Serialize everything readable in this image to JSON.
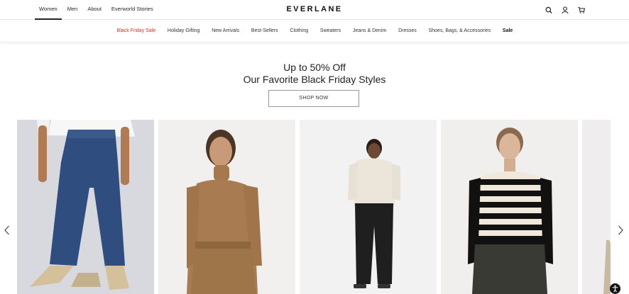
{
  "topnav": {
    "items": [
      "Women",
      "Men",
      "About",
      "Everworld Stories"
    ],
    "active": "Women"
  },
  "brand": "EVERLANE",
  "icons": {
    "search": "search-icon",
    "account": "user-icon",
    "cart": "cart-icon",
    "prev": "chevron-left-icon",
    "next": "chevron-right-icon",
    "accessibility": "accessibility-icon"
  },
  "categories": {
    "items": [
      "Black Friday Sale",
      "Holiday Gifting",
      "New Arrivals",
      "Best-Sellers",
      "Clothing",
      "Sweaters",
      "Jeans & Denim",
      "Dresses",
      "Shoes, Bags, & Accessories",
      "Sale"
    ],
    "highlight_color": "#c5321f"
  },
  "hero": {
    "line1": "Up to 50% Off",
    "line2": "Our Favorite Black Friday Styles",
    "cta": "SHOP NOW"
  },
  "carousel": {
    "products": [
      {
        "image": "model-in-blue-straight-jeans-and-white-tee"
      },
      {
        "image": "model-in-camel-turtleneck-and-trousers"
      },
      {
        "image": "model-in-cream-half-zip-sweater-and-black-pants"
      },
      {
        "image": "model-in-black-and-cream-striped-sweater"
      },
      {
        "image": "partial-product-image"
      }
    ]
  }
}
